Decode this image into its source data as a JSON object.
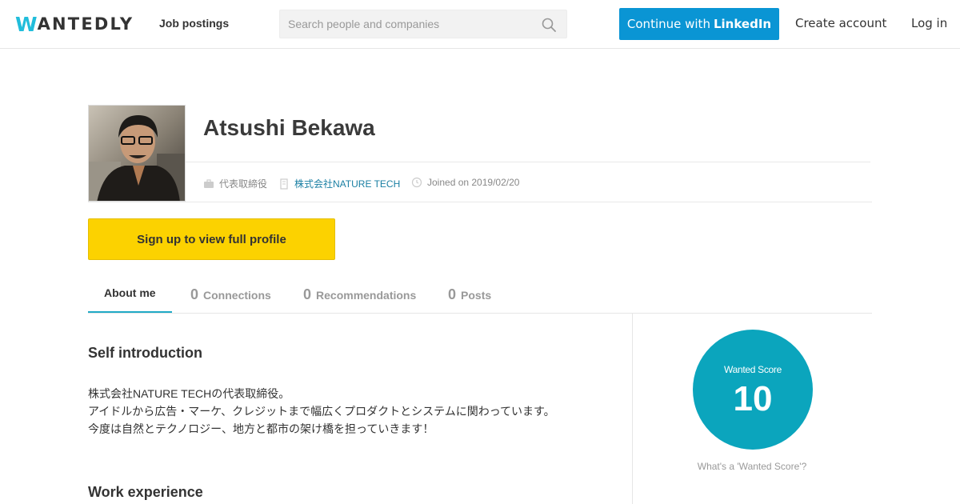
{
  "header": {
    "logo_first": "W",
    "logo_rest": "ANTEDLY",
    "nav_jobs": "Job postings",
    "search_placeholder": "Search people and companies",
    "linkedin_prefix": "Continue with",
    "linkedin_brand": "LinkedIn",
    "create_account": "Create account",
    "login": "Log in"
  },
  "profile": {
    "name": "Atsushi Bekawa",
    "title": "代表取締役",
    "company": "株式会社NATURE TECH",
    "joined": "Joined on 2019/02/20",
    "signup_cta": "Sign up to view full profile"
  },
  "tabs": [
    {
      "label": "About me",
      "count": ""
    },
    {
      "label": "Connections",
      "count": "0"
    },
    {
      "label": "Recommendations",
      "count": "0"
    },
    {
      "label": "Posts",
      "count": "0"
    }
  ],
  "about": {
    "self_intro_heading": "Self introduction",
    "intro_lines": [
      "株式会社NATURE TECHの代表取締役。",
      "アイドルから広告・マーケ、クレジットまで幅広くプロダクトとシステムに関わっています。",
      "今度は自然とテクノロジー、地方と都市の架け橋を担っていきます！"
    ],
    "work_heading": "Work experience"
  },
  "score": {
    "label": "Wanted Score",
    "value": "10",
    "link": "What's a 'Wanted Score'?",
    "color": "#0ba5bd"
  },
  "colors": {
    "brand": "#21bddb",
    "linkedin": "#0a95d4",
    "cta": "#fcd200",
    "link": "#1a7fa3"
  }
}
